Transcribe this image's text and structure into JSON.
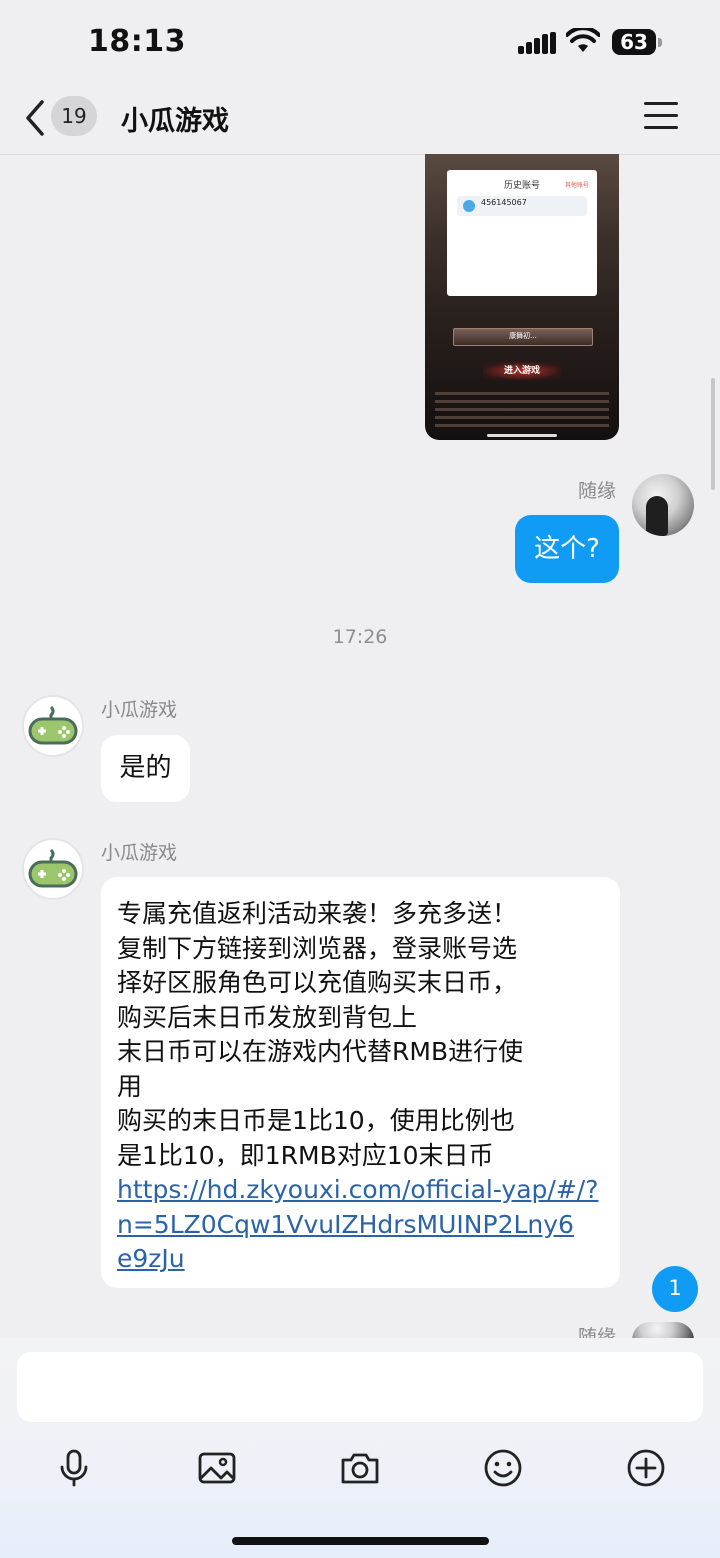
{
  "status_bar": {
    "time": "18:13",
    "battery": "63"
  },
  "header": {
    "back_count": "19",
    "title": "小瓜游戏"
  },
  "shared_screenshot": {
    "dialog_title": "历史账号",
    "dialog_link": "其他账号",
    "account_number": "456145067",
    "server_label": "康舞初...",
    "enter_button": "进入游戏"
  },
  "messages": [
    {
      "sender": "随缘",
      "text": "这个?"
    },
    {
      "divider_time": "17:26"
    },
    {
      "sender": "小瓜游戏",
      "text": "是的"
    },
    {
      "sender": "小瓜游戏",
      "lines": [
        "专属充值返利活动来袭！多充多送！",
        "复制下方链接到浏览器，登录账号选",
        "择好区服角色可以充值购买末日币，",
        "购买后末日币发放到背包上",
        "末日币可以在游戏内代替RMB进行使",
        "用",
        "购买的末日币是1比10，使用比例也",
        "是1比10，即1RMB对应10末日币"
      ],
      "link_lines": [
        "https://hd.zkyouxi.com/official-yap/#/?",
        "n=5LZ0Cqw1VvuIZHdrsMUINP2Lny6",
        "e9zJu"
      ]
    },
    {
      "sender": "随缘"
    }
  ],
  "new_message_badge": "1",
  "composer": {
    "value": ""
  },
  "toolbar": {
    "icons": [
      "microphone-icon",
      "image-icon",
      "camera-icon",
      "emoji-icon",
      "plus-icon"
    ]
  },
  "colors": {
    "accent": "#109cf5",
    "link": "#2b63a8"
  }
}
